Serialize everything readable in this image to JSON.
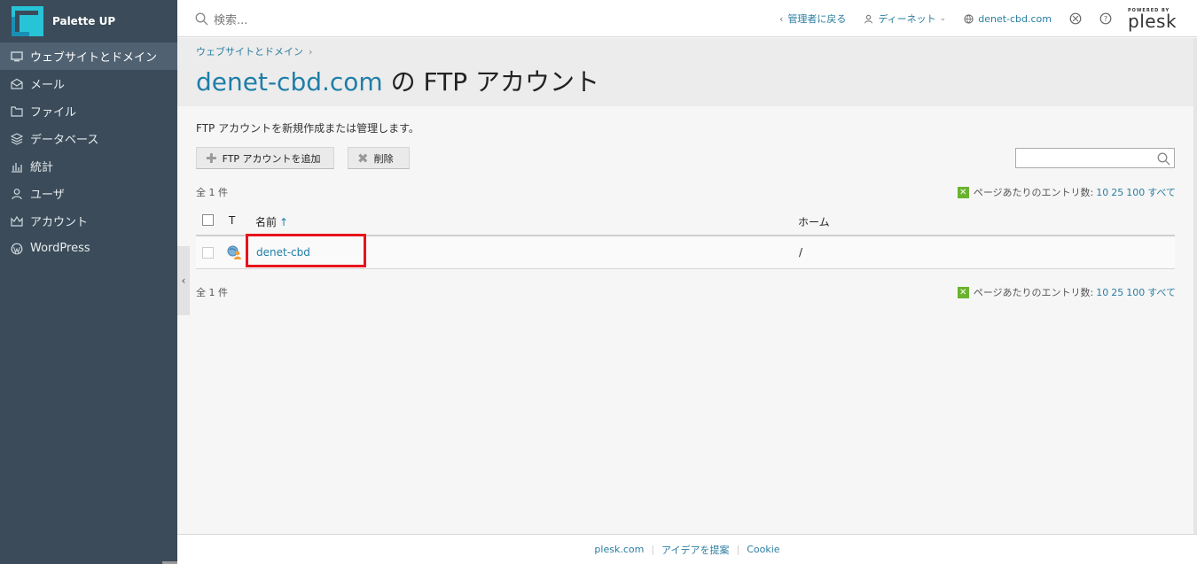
{
  "brand": {
    "name": "Palette UP"
  },
  "sidebar": {
    "items": [
      {
        "label": "ウェブサイトとドメイン",
        "icon": "monitor-icon",
        "active": true
      },
      {
        "label": "メール",
        "icon": "mail-icon"
      },
      {
        "label": "ファイル",
        "icon": "folder-icon"
      },
      {
        "label": "データベース",
        "icon": "database-icon"
      },
      {
        "label": "統計",
        "icon": "chart-icon"
      },
      {
        "label": "ユーザ",
        "icon": "user-icon"
      },
      {
        "label": "アカウント",
        "icon": "account-icon"
      },
      {
        "label": "WordPress",
        "icon": "wordpress-icon"
      }
    ]
  },
  "topbar": {
    "search_placeholder": "検索...",
    "back_admin": "管理者に戻る",
    "user": "ディーネット",
    "domain": "denet-cbd.com",
    "powered_by": "POWERED BY",
    "plesk": "plesk"
  },
  "header": {
    "breadcrumb": "ウェブサイトとドメイン",
    "title_domain": "denet-cbd.com",
    "title_rest": " の FTP アカウント"
  },
  "content": {
    "description": "FTP アカウントを新規作成または管理します。",
    "add_button": "FTP アカウントを追加",
    "delete_button": "削除",
    "count_text": "全 1 件",
    "per_page_label": "ページあたりのエントリ数:",
    "per_page_options": [
      "10",
      "25",
      "100",
      "すべて"
    ],
    "columns": {
      "type": "T",
      "name": "名前",
      "home": "ホーム"
    },
    "sort_arrow": "↑",
    "rows": [
      {
        "name": "denet-cbd",
        "home": "/"
      }
    ]
  },
  "footer": {
    "links": [
      "plesk.com",
      "アイデアを提案",
      "Cookie"
    ]
  },
  "colors": {
    "sidebar_bg": "#3b4b59",
    "accent": "#1f7ea8",
    "highlight": "#e8141b"
  }
}
